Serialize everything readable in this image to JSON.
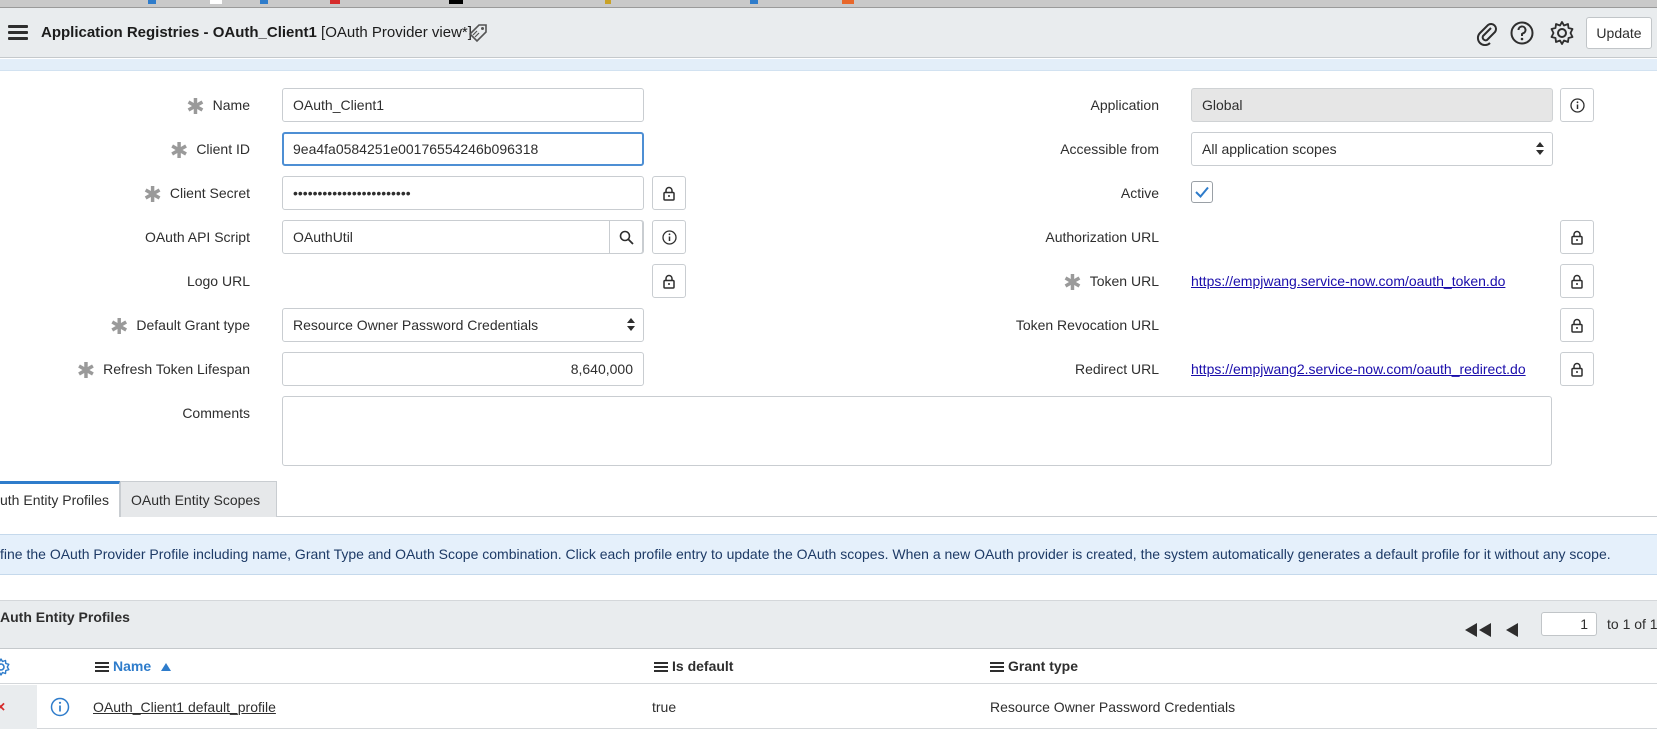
{
  "header": {
    "title_bold": "Application Registries - OAuth_Client1",
    "title_view": "[OAuth Provider view*]",
    "update_label": "Update"
  },
  "form": {
    "name_label": "Name",
    "name_value": "OAuth_Client1",
    "client_id_label": "Client ID",
    "client_id_value": "9ea4fa0584251e00176554246b096318",
    "client_secret_label": "Client Secret",
    "client_secret_value": "••••••••••••••••••••••••",
    "api_script_label": "OAuth API Script",
    "api_script_value": "OAuthUtil",
    "logo_url_label": "Logo URL",
    "grant_type_label": "Default Grant type",
    "grant_type_value": "Resource Owner Password Credentials",
    "refresh_label": "Refresh Token Lifespan",
    "refresh_value": "8,640,000",
    "comments_label": "Comments",
    "application_label": "Application",
    "application_value": "Global",
    "accessible_label": "Accessible from",
    "accessible_value": "All application scopes",
    "active_label": "Active",
    "active_checked": true,
    "auth_url_label": "Authorization URL",
    "token_url_label": "Token URL",
    "token_url_value": "https://empjwang.service-now.com/oauth_token.do",
    "revocation_label": "Token Revocation URL",
    "redirect_label": "Redirect URL",
    "redirect_value": "https://empjwang2.service-now.com/oauth_redirect.do"
  },
  "tabs": [
    {
      "label": "uth Entity Profiles"
    },
    {
      "label": "OAuth Entity Scopes"
    }
  ],
  "info_text": "fine the OAuth Provider Profile including name, Grant Type and OAuth Scope combination. Click each profile entry to update the OAuth scopes. When a new OAuth provider is created, the system automatically generates a default profile for it without any scope.",
  "list": {
    "title": "Auth Entity Profiles",
    "page": "1",
    "page_text": "to 1 of 1",
    "columns": {
      "name": "Name",
      "is_default": "Is default",
      "grant_type": "Grant type"
    },
    "rows": [
      {
        "name": "OAuth_Client1 default_profile",
        "is_default": "true",
        "grant_type": "Resource Owner Password Credentials"
      }
    ]
  },
  "colors": {
    "accent": "#2e7ccb",
    "link": "#1a0dab",
    "header_bg": "#e9ecee",
    "info_bg": "#e5f0fb"
  }
}
